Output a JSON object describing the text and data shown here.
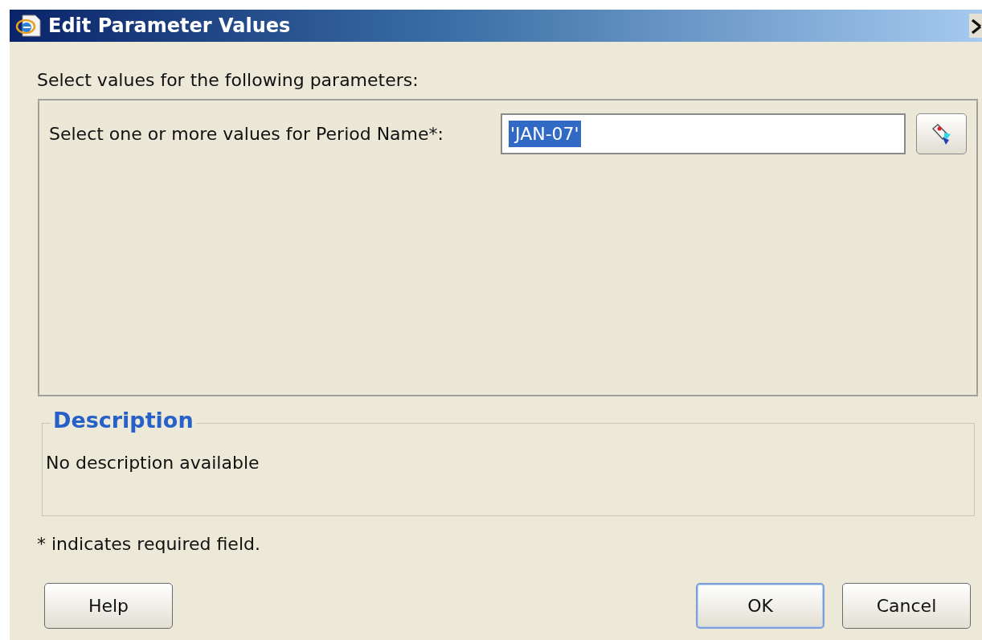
{
  "window": {
    "title": "Edit Parameter Values"
  },
  "intro": "Select values for the following parameters:",
  "parameters": [
    {
      "label": "Select one or more values for Period Name*:",
      "value": "'JAN-07'",
      "selected": true
    }
  ],
  "description": {
    "legend": "Description",
    "text": "No description available"
  },
  "footnote": "* indicates required field.",
  "buttons": [
    {
      "label": "Help",
      "default": false
    },
    {
      "label": "OK",
      "default": true
    },
    {
      "label": "Cancel",
      "default": false
    }
  ]
}
